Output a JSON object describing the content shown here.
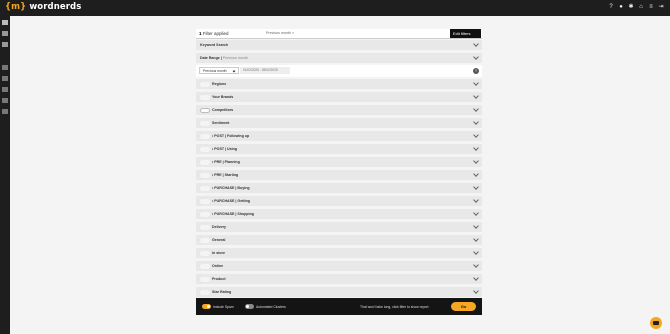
{
  "app": {
    "logo_text": "wordnerds",
    "logo_brace": "{m}"
  },
  "header": {
    "icons": [
      "help-icon",
      "bell-icon",
      "settings-icon",
      "home-icon",
      "list-icon",
      "logout-icon"
    ]
  },
  "rail": {
    "icons": [
      "chat-icon",
      "grid-icon",
      "grid-alt-icon",
      "swap-icon",
      "alarm-icon",
      "message-icon",
      "upload-icon",
      "pin-icon"
    ]
  },
  "filters": {
    "count": "1",
    "count_label": "Filter applied",
    "chip": "Previous month ×",
    "edit_label": "Edit filters"
  },
  "keyword_search": "Keyword Search",
  "date_range": {
    "label": "Date Range",
    "sub": "Previous month",
    "select": "Previous month",
    "range": "01/02/2025 - 28/02/2025"
  },
  "sections": [
    {
      "label": "Regions",
      "toggle": "off"
    },
    {
      "label": "Your Brands",
      "toggle": "off"
    },
    {
      "label": "Competitors",
      "toggle": "on"
    },
    {
      "label": "Sentiment",
      "toggle": "off"
    },
    {
      "label": "• POST | Following up",
      "toggle": "off"
    },
    {
      "label": "• POST | Using",
      "toggle": "off"
    },
    {
      "label": "• PRE | Planning",
      "toggle": "off"
    },
    {
      "label": "• PRE | Starting",
      "toggle": "off"
    },
    {
      "label": "• PURCHASE | Buying",
      "toggle": "off"
    },
    {
      "label": "• PURCHASE | Getting",
      "toggle": "off"
    },
    {
      "label": "• PURCHASE | Shopping",
      "toggle": "off"
    },
    {
      "label": "Delivery",
      "toggle": "off"
    },
    {
      "label": "General",
      "toggle": "off"
    },
    {
      "label": "In store",
      "toggle": "off"
    },
    {
      "label": "Online",
      "toggle": "off"
    },
    {
      "label": "Product",
      "toggle": "off"
    },
    {
      "label": "Star Rating",
      "toggle": "off"
    }
  ],
  "footer": {
    "include_spam": "Include Spam",
    "automated_clusters": "Automated Clusters",
    "message": "That won't take long, click filter to show report.",
    "go": "Go"
  },
  "colors": {
    "accent": "#f5a623",
    "dark": "#1e1e1e"
  }
}
